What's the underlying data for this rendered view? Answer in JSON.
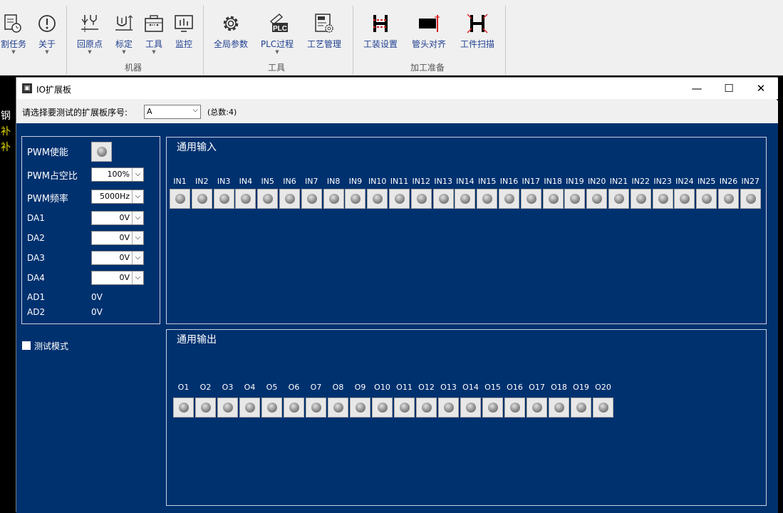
{
  "ribbon": {
    "buttons": [
      {
        "id": "task",
        "label": "割任务",
        "dropdown": true
      },
      {
        "id": "about",
        "label": "关于",
        "dropdown": true
      },
      {
        "id": "home",
        "label": "回原点",
        "dropdown": true
      },
      {
        "id": "calib",
        "label": "标定",
        "dropdown": true
      },
      {
        "id": "tools",
        "label": "工具",
        "dropdown": true
      },
      {
        "id": "monitor",
        "label": "监控",
        "dropdown": false
      },
      {
        "id": "global",
        "label": "全局参数",
        "dropdown": false
      },
      {
        "id": "plc",
        "label": "PLC过程",
        "dropdown": true
      },
      {
        "id": "craft",
        "label": "工艺管理",
        "dropdown": false
      },
      {
        "id": "fixture",
        "label": "工装设置",
        "dropdown": false
      },
      {
        "id": "pipealign",
        "label": "管头对齐",
        "dropdown": false
      },
      {
        "id": "scan",
        "label": "工件扫描",
        "dropdown": false
      }
    ],
    "groups": {
      "machine": "机器",
      "tools": "工具",
      "prep": "加工准备"
    },
    "plc_icon_text": "PLC"
  },
  "left_strip": [
    "钢",
    "补",
    "补"
  ],
  "dialog": {
    "title": "IO扩展板",
    "controls": {
      "minimize": "—",
      "maximize": "☐",
      "close": "✕"
    },
    "select_label": "请选择要测试的扩展板序号:",
    "select_value": "A",
    "select_arrow": "⌵",
    "total": "(总数:4)"
  },
  "left_panel": {
    "pwm_enable_label": "PWM使能",
    "pwm_duty_label": "PWM占空比",
    "pwm_duty_value": "100%",
    "pwm_freq_label": "PWM频率",
    "pwm_freq_value": "5000Hz",
    "da": [
      {
        "label": "DA1",
        "value": "0V"
      },
      {
        "label": "DA2",
        "value": "0V"
      },
      {
        "label": "DA3",
        "value": "0V"
      },
      {
        "label": "DA4",
        "value": "0V"
      }
    ],
    "ad": [
      {
        "label": "AD1",
        "value": "0V"
      },
      {
        "label": "AD2",
        "value": "0V"
      }
    ],
    "dropdown_arrow": "⌵"
  },
  "test_mode_label": "测试模式",
  "inputs": {
    "title": "通用输入",
    "labels": [
      "IN1",
      "IN2",
      "IN3",
      "IN4",
      "IN5",
      "IN6",
      "IN7",
      "IN8",
      "IN9",
      "IN10",
      "IN11",
      "IN12",
      "IN13",
      "IN14",
      "IN15",
      "IN16",
      "IN17",
      "IN18",
      "IN19",
      "IN20",
      "IN21",
      "IN22",
      "IN23",
      "IN24",
      "IN25",
      "IN26",
      "IN27"
    ]
  },
  "outputs": {
    "title": "通用输出",
    "labels": [
      "O1",
      "O2",
      "O3",
      "O4",
      "O5",
      "O6",
      "O7",
      "O8",
      "O9",
      "O10",
      "O11",
      "O12",
      "O13",
      "O14",
      "O15",
      "O16",
      "O17",
      "O18",
      "O19",
      "O20"
    ]
  },
  "colors": {
    "panel_bg": "#00316f",
    "ribbon_label": "#1f3f8f",
    "icon_red": "#d92020"
  }
}
